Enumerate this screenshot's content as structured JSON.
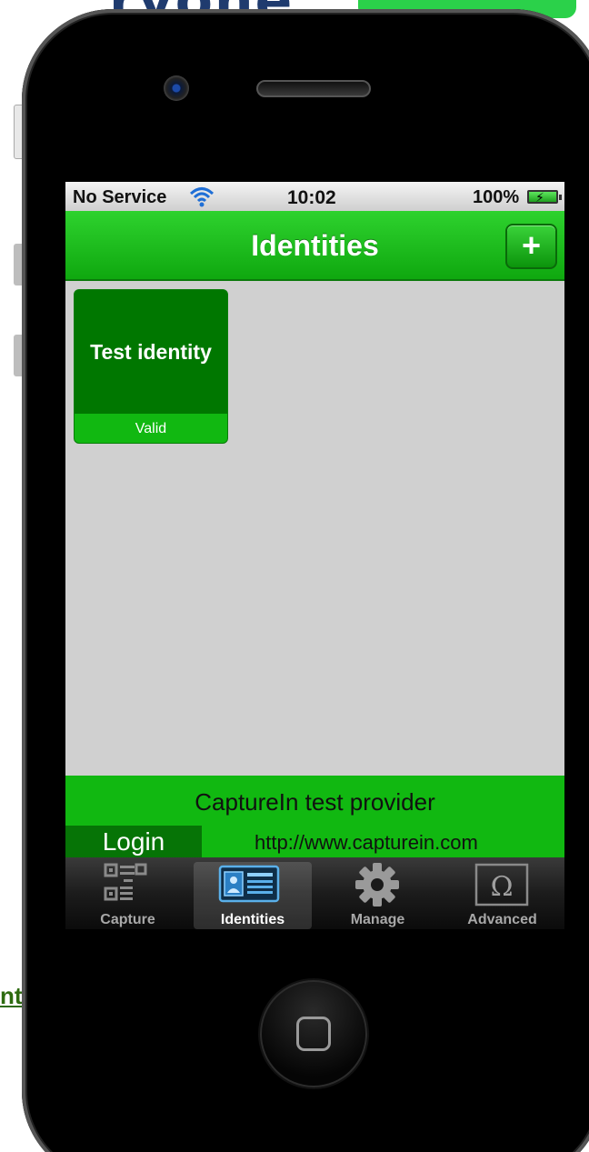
{
  "status_bar": {
    "carrier": "No Service",
    "time": "10:02",
    "battery": "100%"
  },
  "nav_bar": {
    "title": "Identities",
    "add_label": "+"
  },
  "identities": [
    {
      "name": "Test identity",
      "status": "Valid"
    }
  ],
  "provider": {
    "name": "CaptureIn test provider",
    "login_label": "Login",
    "url": "http://www.capturein.com"
  },
  "tabs": [
    {
      "label": "Capture",
      "icon": "qr-code-icon",
      "selected": false
    },
    {
      "label": "Identities",
      "icon": "id-card-icon",
      "selected": true
    },
    {
      "label": "Manage",
      "icon": "gear-icon",
      "selected": false
    },
    {
      "label": "Advanced",
      "icon": "omega-icon",
      "selected": false
    }
  ],
  "colors": {
    "nav_green": "#1fbf1f",
    "tile_green": "#007700",
    "panel_green": "#11b811",
    "login_green": "#067406",
    "screen_bg": "#d0d0d0"
  }
}
